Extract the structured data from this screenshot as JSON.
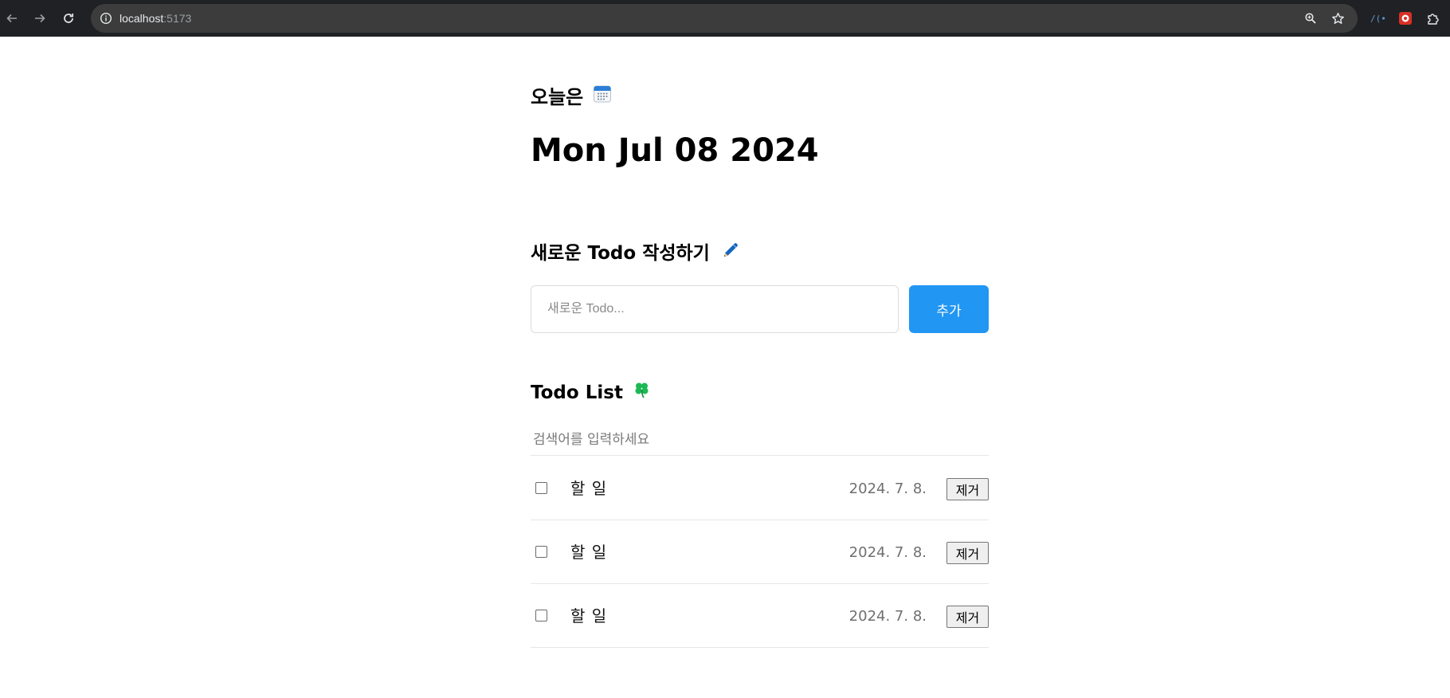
{
  "browser": {
    "url_host": "localhost",
    "url_port": ":5173",
    "icons": [
      "back-arrow-icon",
      "forward-arrow-icon",
      "reload-icon",
      "site-info-icon",
      "zoom-icon",
      "bookmark-star-icon",
      "extension-icon",
      "extensions-puzzle-icon"
    ]
  },
  "header": {
    "today_label": "오늘은",
    "today_icon": "calendar-icon",
    "date": "Mon Jul 08 2024"
  },
  "editor": {
    "title": "새로운 Todo 작성하기",
    "title_icon": "pencil-icon",
    "placeholder": "새로운 Todo...",
    "add_label": "추가"
  },
  "list": {
    "title": "Todo List",
    "title_icon": "clover-icon",
    "search_placeholder": "검색어를 입력하세요",
    "items": [
      {
        "content": "할 일",
        "date": "2024. 7. 8.",
        "remove_label": "제거",
        "done": false
      },
      {
        "content": "할 일",
        "date": "2024. 7. 8.",
        "remove_label": "제거",
        "done": false
      },
      {
        "content": "할 일",
        "date": "2024. 7. 8.",
        "remove_label": "제거",
        "done": false
      }
    ]
  },
  "colors": {
    "accent": "#2196f3",
    "chrome_bg": "#202124",
    "omnibox_bg": "#3c3c3c"
  }
}
